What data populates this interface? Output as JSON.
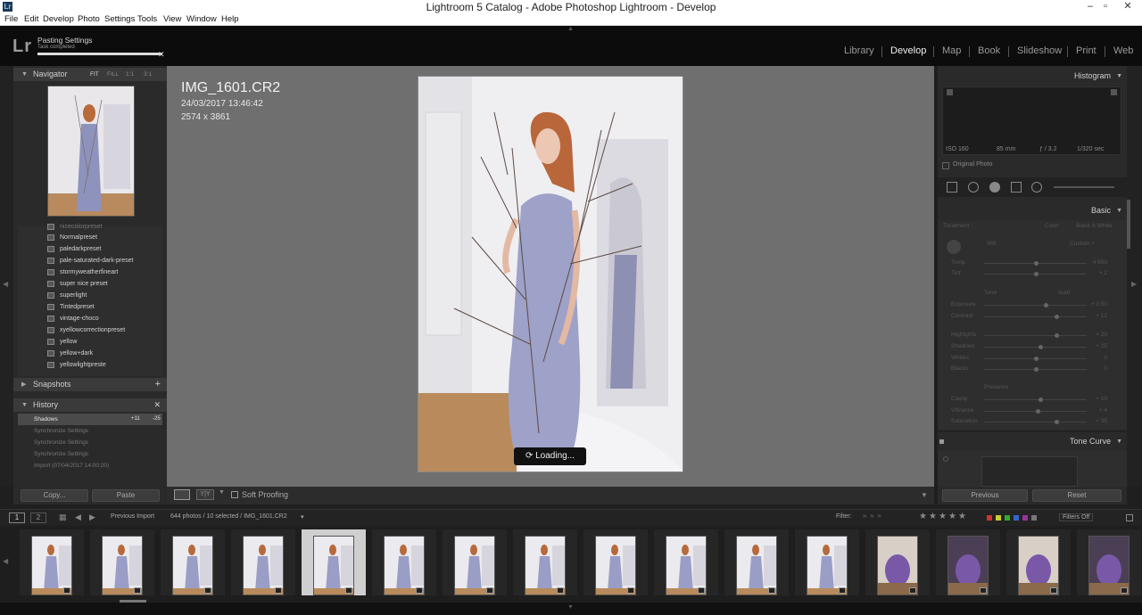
{
  "window": {
    "title": "Lightroom 5 Catalog - Adobe Photoshop Lightroom - Develop",
    "app_icon": "Lr",
    "controls": [
      "–",
      "▫",
      "✕"
    ]
  },
  "menu": [
    "File",
    "Edit",
    "Develop",
    "Photo",
    "Settings",
    "Tools",
    "View",
    "Window",
    "Help"
  ],
  "identity": {
    "logo": "Lr",
    "task_title": "Pasting Settings",
    "task_status": "Task completed",
    "progress": 1.0,
    "close": "✕"
  },
  "modules": [
    "Library",
    "Develop",
    "Map",
    "Book",
    "Slideshow",
    "Print",
    "Web"
  ],
  "active_module": "Develop",
  "navigator": {
    "title": "Navigator",
    "options": [
      "FIT",
      "FILL",
      "1:1",
      "3:1"
    ]
  },
  "presets": {
    "partial_item": "nicecolorpreset",
    "items": [
      "Normalpreset",
      "paledarkpreset",
      "pale-saturated-dark-preset",
      "stormyweatherfineart",
      "super nice preset",
      "superlight",
      "Tintedpreset",
      "vintage-choco",
      "xyellowcorrectionpreset",
      "yellow",
      "yellow+dark",
      "yellowlightpreste"
    ]
  },
  "snapshots": {
    "title": "Snapshots",
    "add": "+"
  },
  "history": {
    "title": "History",
    "close": "✕",
    "items": [
      {
        "label": "Shadows",
        "a": "+11",
        "b": "-25",
        "selected": true
      },
      {
        "label": "Synchronize Settings",
        "a": "",
        "b": "",
        "selected": false
      },
      {
        "label": "Synchronize Settings",
        "a": "",
        "b": "",
        "selected": false
      },
      {
        "label": "Synchronize Settings",
        "a": "",
        "b": "",
        "selected": false
      },
      {
        "label": "Import (07/04/2017 14:00:20)",
        "a": "",
        "b": "",
        "selected": false
      }
    ]
  },
  "left_buttons": {
    "copy": "Copy...",
    "paste": "Paste"
  },
  "image_info": {
    "filename": "IMG_1601.CR2",
    "date": "24/03/2017 13:46:42",
    "dimensions": "2574 x 3861"
  },
  "loading": "Loading...",
  "toolbar": {
    "soft_proofing": "Soft Proofing",
    "yy": "Y|Y"
  },
  "histogram": {
    "title": "Histogram",
    "iso": "ISO 160",
    "focal": "85 mm",
    "aperture": "ƒ / 3.2",
    "shutter": "1/320 sec",
    "original_photo": "Original Photo"
  },
  "basic": {
    "title": "Basic",
    "treatment": "Treatment :",
    "color": "Color",
    "bw": "Black & White",
    "wb": "WB :",
    "wb_value": "Custom ÷",
    "tone": "Tone",
    "auto": "Auto",
    "presence": "Presence",
    "sliders": [
      {
        "label": "Temp",
        "value": "4 600",
        "level": 0.5
      },
      {
        "label": "Tint",
        "value": "+ 2",
        "level": 0.5
      },
      {
        "label": "Exposure",
        "value": "+ 0.50",
        "level": 0.6
      },
      {
        "label": "Contrast",
        "value": "+ 12",
        "level": 0.7
      },
      {
        "label": "Highlights",
        "value": "+ 20",
        "level": 0.7
      },
      {
        "label": "Shadows",
        "value": "+ 25",
        "level": 0.55
      },
      {
        "label": "Whites",
        "value": "0",
        "level": 0.5
      },
      {
        "label": "Blacks",
        "value": "0",
        "level": 0.5
      },
      {
        "label": "Clarity",
        "value": "+ 10",
        "level": 0.55
      },
      {
        "label": "Vibrance",
        "value": "+ 4",
        "level": 0.52
      },
      {
        "label": "Saturation",
        "value": "+ 35",
        "level": 0.7
      }
    ]
  },
  "tone_curve": {
    "title": "Tone Curve"
  },
  "right_buttons": {
    "previous": "Previous",
    "reset": "Reset"
  },
  "filmstrip": {
    "page1": "1",
    "page2": "2",
    "source": "Previous Import",
    "count": "644 photos / 10 selected / IMG_1601.CR2",
    "filter_label": "Filter:",
    "filters_off": "Filters Off",
    "selected_index": 4,
    "thumbs": 16
  }
}
